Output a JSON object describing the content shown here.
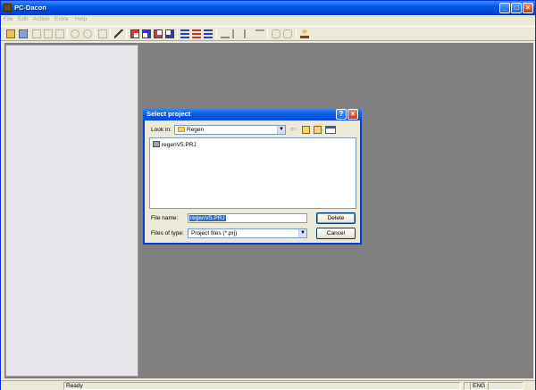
{
  "window": {
    "title": "PC-Dacon",
    "controls": {
      "minimize": "_",
      "maximize": "□",
      "close": "×"
    }
  },
  "menu": [
    "File",
    "Edit",
    "Action",
    "Extra",
    "Help"
  ],
  "toolbar": {
    "icons": [
      "open-icon",
      "save-icon",
      "cut-icon",
      "copy-icon",
      "paste-icon",
      "undo-icon",
      "redo-icon",
      "print-icon",
      "wand-icon",
      "grid-icon-1",
      "grid-icon-2",
      "grid-icon-3",
      "grid-icon-4",
      "align-icon-1",
      "align-icon-2",
      "align-icon-3",
      "download-icon",
      "step-icon-1",
      "step-icon-2",
      "link-icon-1",
      "link-icon-2",
      "help-icon"
    ]
  },
  "statusbar": {
    "left": "",
    "status": "Ready",
    "lang": "ENG"
  },
  "dialog": {
    "title": "Select project",
    "help_button": "?",
    "close_button": "×",
    "look_in_label": "Look in:",
    "look_in_value": "Regen",
    "files": [
      "regenV5.PRJ"
    ],
    "file_name_label": "File name:",
    "file_name_value": "regenV5.PRJ",
    "files_of_type_label": "Files of type:",
    "files_of_type_value": "Project files (*.prj)",
    "delete_button": "Delete",
    "cancel_button": "Cancel"
  }
}
